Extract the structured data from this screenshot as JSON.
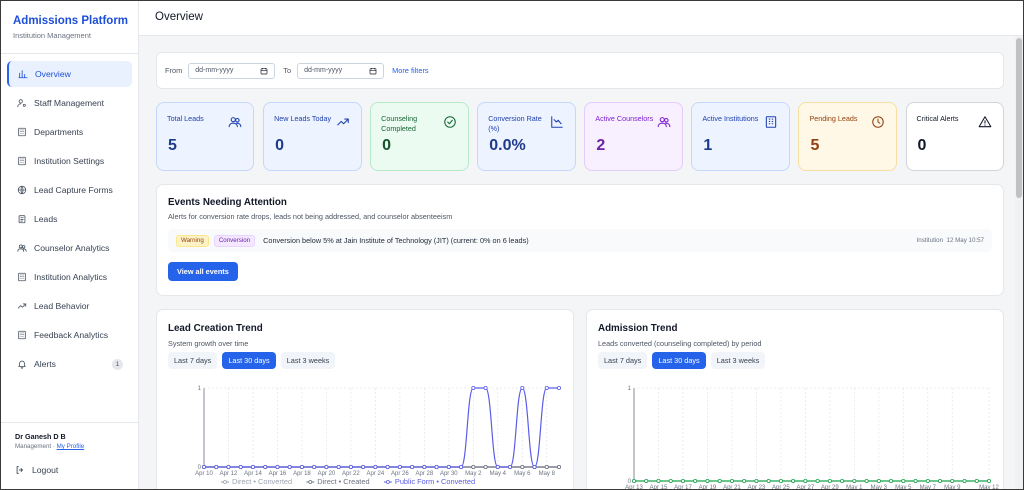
{
  "brand": {
    "title": "Admissions Platform",
    "subtitle": "Institution Management"
  },
  "sidebar": {
    "items": [
      {
        "label": "Overview",
        "icon": "bar-chart-icon",
        "active": true
      },
      {
        "label": "Staff Management",
        "icon": "user-cog-icon"
      },
      {
        "label": "Departments",
        "icon": "building-icon"
      },
      {
        "label": "Institution Settings",
        "icon": "building-icon"
      },
      {
        "label": "Lead Capture Forms",
        "icon": "globe-icon"
      },
      {
        "label": "Leads",
        "icon": "clipboard-icon"
      },
      {
        "label": "Counselor Analytics",
        "icon": "users-icon"
      },
      {
        "label": "Institution Analytics",
        "icon": "building-icon"
      },
      {
        "label": "Lead Behavior",
        "icon": "trend-icon"
      },
      {
        "label": "Feedback Analytics",
        "icon": "building-icon"
      },
      {
        "label": "Alerts",
        "icon": "bell-icon",
        "badge": "1"
      }
    ],
    "user": {
      "name": "Dr Ganesh D B",
      "role": "Management · ",
      "profile_link": "My Profile"
    },
    "logout": "Logout"
  },
  "topbar": {
    "title": "Overview"
  },
  "filters": {
    "from_label": "From",
    "from_value": "dd-mm-yyyy",
    "to_label": "To",
    "to_value": "dd-mm-yyyy",
    "more_filters": "More filters"
  },
  "stats": [
    {
      "label": "Total Leads",
      "value": "5",
      "icon": "users-icon",
      "bg": "#eef4ff",
      "border": "#c7d7fb",
      "label_color": "#1e40af",
      "value_color": "#1e3a8a",
      "icon_color": "#1e40af"
    },
    {
      "label": "New Leads Today",
      "value": "0",
      "icon": "trend-up-icon",
      "bg": "#eef4ff",
      "border": "#c7d7fb",
      "label_color": "#1e40af",
      "value_color": "#1e3a8a",
      "icon_color": "#1e40af"
    },
    {
      "label": "Counseling Completed",
      "value": "0",
      "icon": "check-circle-icon",
      "bg": "#ecfbf1",
      "border": "#b7ebc8",
      "label_color": "#166534",
      "value_color": "#14532d",
      "icon_color": "#166534"
    },
    {
      "label": "Conversion Rate (%)",
      "value": "0.0%",
      "icon": "chart-down-icon",
      "bg": "#eef4ff",
      "border": "#c7d7fb",
      "label_color": "#1e40af",
      "value_color": "#1e3a8a",
      "icon_color": "#1e40af"
    },
    {
      "label": "Active Counselors",
      "value": "2",
      "icon": "users-icon",
      "bg": "#f8efff",
      "border": "#e4ccfb",
      "label_color": "#7e22ce",
      "value_color": "#6b21a8",
      "icon_color": "#7e22ce"
    },
    {
      "label": "Active Institutions",
      "value": "1",
      "icon": "building-icon",
      "bg": "#eef4ff",
      "border": "#c7d7fb",
      "label_color": "#1e40af",
      "value_color": "#1e3a8a",
      "icon_color": "#1e40af"
    },
    {
      "label": "Pending Leads",
      "value": "5",
      "icon": "clock-icon",
      "bg": "#fff8e6",
      "border": "#f6dfa1",
      "label_color": "#92400e",
      "value_color": "#92400e",
      "icon_color": "#92400e"
    },
    {
      "label": "Critical Alerts",
      "value": "0",
      "icon": "alert-triangle-icon",
      "bg": "#ffffff",
      "border": "#d1d5db",
      "label_color": "#111827",
      "value_color": "#111827",
      "icon_color": "#111827"
    }
  ],
  "events": {
    "title": "Events Needing Attention",
    "subtitle": "Alerts for conversion rate drops, leads not being addressed, and counselor absenteeism",
    "rows": [
      {
        "tag1": "Warning",
        "tag2": "Conversion",
        "text": "Conversion below 5% at Jain Institute of Technology (JIT) (current: 0% on 6 leads)",
        "scope": "Institution",
        "time": "12 May 10:57"
      }
    ],
    "view_all": "View all events"
  },
  "lead_trend": {
    "title": "Lead Creation Trend",
    "subtitle": "System growth over time",
    "ranges": [
      "Last 7 days",
      "Last 30 days",
      "Last 3 weeks"
    ],
    "active_range": 1
  },
  "admission_trend": {
    "title": "Admission Trend",
    "subtitle": "Leads converted (counseling completed) by period",
    "ranges": [
      "Last 7 days",
      "Last 30 days",
      "Last 3 weeks"
    ],
    "active_range": 1
  },
  "chart_data": [
    {
      "type": "line",
      "title": "Lead Creation Trend",
      "subtitle": "System growth over time",
      "x": [
        "Apr 10",
        "Apr 11",
        "Apr 12",
        "Apr 13",
        "Apr 14",
        "Apr 15",
        "Apr 16",
        "Apr 17",
        "Apr 18",
        "Apr 19",
        "Apr 20",
        "Apr 21",
        "Apr 22",
        "Apr 23",
        "Apr 24",
        "Apr 25",
        "Apr 26",
        "Apr 27",
        "Apr 28",
        "Apr 29",
        "Apr 30",
        "May 1",
        "May 2",
        "May 3",
        "May 4",
        "May 5",
        "May 6",
        "May 7",
        "May 8",
        "May 9"
      ],
      "x_tick_labels": [
        "Apr 10",
        "Apr 12",
        "Apr 14",
        "Apr 16",
        "Apr 18",
        "Apr 20",
        "Apr 22",
        "Apr 24",
        "Apr 26",
        "Apr 28",
        "Apr 30",
        "May 2",
        "May 4",
        "May 6",
        "May 8"
      ],
      "ylim": [
        0,
        1
      ],
      "y_ticks": [
        "0",
        "1"
      ],
      "series": [
        {
          "name": "Direct • Converted",
          "color": "#9ca3af",
          "values": [
            0,
            0,
            0,
            0,
            0,
            0,
            0,
            0,
            0,
            0,
            0,
            0,
            0,
            0,
            0,
            0,
            0,
            0,
            0,
            0,
            0,
            0,
            0,
            0,
            0,
            0,
            0,
            0,
            0,
            0
          ]
        },
        {
          "name": "Direct • Created",
          "color": "#6b7280",
          "values": [
            0,
            0,
            0,
            0,
            0,
            0,
            0,
            0,
            0,
            0,
            0,
            0,
            0,
            0,
            0,
            0,
            0,
            0,
            0,
            0,
            0,
            0,
            0,
            0,
            0,
            0,
            0,
            0,
            0,
            0
          ]
        },
        {
          "name": "Public Form • Converted",
          "color": "#5b5ce8",
          "values": [
            0,
            0,
            0,
            0,
            0,
            0,
            0,
            0,
            0,
            0,
            0,
            0,
            0,
            0,
            0,
            0,
            0,
            0,
            0,
            0,
            0,
            0,
            1,
            1,
            0,
            0,
            1,
            0,
            1,
            1
          ]
        }
      ],
      "legend": "bottom",
      "grid": true
    },
    {
      "type": "line",
      "title": "Admission Trend",
      "subtitle": "Leads converted (counseling completed) by period",
      "x": [
        "Apr 13",
        "Apr 14",
        "Apr 15",
        "Apr 16",
        "Apr 17",
        "Apr 18",
        "Apr 19",
        "Apr 20",
        "Apr 21",
        "Apr 22",
        "Apr 23",
        "Apr 24",
        "Apr 25",
        "Apr 26",
        "Apr 27",
        "Apr 28",
        "Apr 29",
        "Apr 30",
        "May 1",
        "May 2",
        "May 3",
        "May 4",
        "May 5",
        "May 6",
        "May 7",
        "May 8",
        "May 9",
        "May 10",
        "May 11",
        "May 12"
      ],
      "x_tick_labels": [
        "Apr 13",
        "Apr 15",
        "Apr 17",
        "Apr 19",
        "Apr 21",
        "Apr 23",
        "Apr 25",
        "Apr 27",
        "Apr 29",
        "May 1",
        "May 3",
        "May 5",
        "May 7",
        "May 9",
        "May 12"
      ],
      "ylim": [
        0,
        1
      ],
      "y_ticks": [
        "0",
        "1"
      ],
      "series": [
        {
          "color": "#16a34a",
          "values": [
            0,
            0,
            0,
            0,
            0,
            0,
            0,
            0,
            0,
            0,
            0,
            0,
            0,
            0,
            0,
            0,
            0,
            0,
            0,
            0,
            0,
            0,
            0,
            0,
            0,
            0,
            0,
            0,
            0,
            0
          ]
        }
      ],
      "grid": true
    }
  ]
}
